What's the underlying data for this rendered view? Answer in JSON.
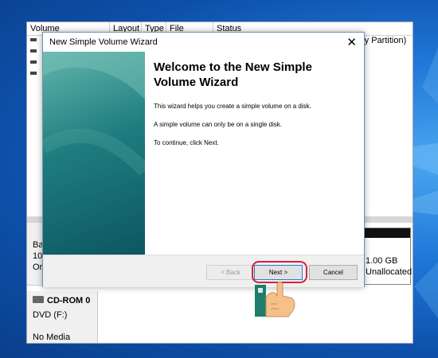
{
  "disk_management": {
    "columns": [
      "Volume",
      "Layout",
      "Type",
      "File System",
      "Status"
    ],
    "status_tail": "ry Partition)",
    "disk0": {
      "line1": "Bas",
      "line2": "10",
      "line3": "Or"
    },
    "unallocated": {
      "size": "1.00 GB",
      "label": "Unallocated"
    },
    "cdrom": {
      "name": "CD-ROM 0",
      "drive": "DVD (F:)",
      "media": "No Media"
    }
  },
  "wizard": {
    "title": "New Simple Volume Wizard",
    "close_glyph": "✕",
    "heading": "Welcome to the New Simple Volume Wizard",
    "paragraphs": [
      "This wizard helps you create a simple volume on a disk.",
      "A simple volume can only be on a single disk.",
      "To continue, click Next."
    ],
    "buttons": {
      "back": "< Back",
      "next": "Next >",
      "cancel": "Cancel"
    }
  },
  "icons": [
    "close-icon",
    "disk-icon",
    "cd-drive-icon",
    "pointing-hand-icon"
  ],
  "colors": {
    "highlight": "#d6213a",
    "sidebar": "#1e7d7f",
    "desktop": "#1f78d8"
  }
}
